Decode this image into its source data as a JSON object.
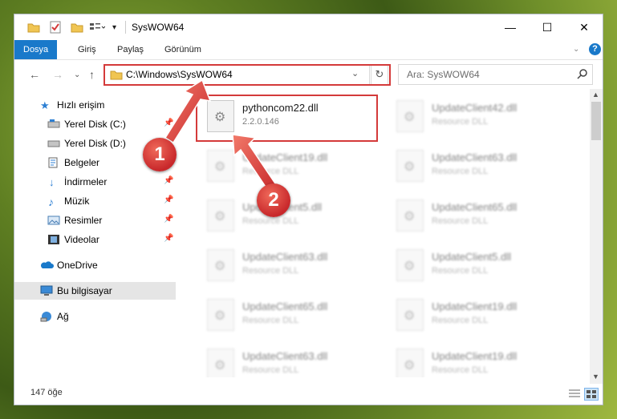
{
  "window": {
    "title": "SysWOW64",
    "controls": {
      "minimize": "—",
      "maximize": "☐",
      "close": "✕"
    }
  },
  "ribbon": {
    "tabs": [
      "Dosya",
      "Giriş",
      "Paylaş",
      "Görünüm"
    ],
    "help": "?"
  },
  "address": {
    "path": "C:\\Windows\\SysWOW64",
    "search_placeholder": "Ara: SysWOW64"
  },
  "sidebar": {
    "items": [
      {
        "label": "Hızlı erişim",
        "icon": "star-icon",
        "pinned": false
      },
      {
        "label": "Yerel Disk (C:)",
        "icon": "drive-icon",
        "pinned": true
      },
      {
        "label": "Yerel Disk (D:)",
        "icon": "drive-icon",
        "pinned": true
      },
      {
        "label": "Belgeler",
        "icon": "documents-icon",
        "pinned": true
      },
      {
        "label": "İndirmeler",
        "icon": "download-icon",
        "pinned": true
      },
      {
        "label": "Müzik",
        "icon": "music-icon",
        "pinned": true
      },
      {
        "label": "Resimler",
        "icon": "pictures-icon",
        "pinned": true
      },
      {
        "label": "Videolar",
        "icon": "videos-icon",
        "pinned": true
      },
      {
        "label": "OneDrive",
        "icon": "cloud-icon",
        "pinned": false
      },
      {
        "label": "Bu bilgisayar",
        "icon": "computer-icon",
        "pinned": false
      },
      {
        "label": "Ağ",
        "icon": "network-icon",
        "pinned": false
      }
    ]
  },
  "files": [
    {
      "name": "pythoncom22.dll",
      "sub": "2.2.0.146"
    },
    {
      "name": "UpdateClient42.dll",
      "sub": "Resource DLL"
    },
    {
      "name": "UpdateClient19.dll",
      "sub": "Resource DLL"
    },
    {
      "name": "UpdateClient63.dll",
      "sub": "Resource DLL"
    },
    {
      "name": "UpdateClient5.dll",
      "sub": "Resource DLL"
    },
    {
      "name": "UpdateClient65.dll",
      "sub": "Resource DLL"
    },
    {
      "name": "UpdateClient63.dll",
      "sub": "Resource DLL"
    },
    {
      "name": "UpdateClient5.dll",
      "sub": "Resource DLL"
    },
    {
      "name": "UpdateClient65.dll",
      "sub": "Resource DLL"
    },
    {
      "name": "UpdateClient19.dll",
      "sub": "Resource DLL"
    },
    {
      "name": "UpdateClient63.dll",
      "sub": "Resource DLL"
    },
    {
      "name": "UpdateClient19.dll",
      "sub": "Resource DLL"
    }
  ],
  "status": {
    "count": "147 öğe"
  },
  "annotations": {
    "step1": "1",
    "step2": "2"
  },
  "colors": {
    "accent": "#1979ca",
    "highlight": "#d43a3a"
  }
}
